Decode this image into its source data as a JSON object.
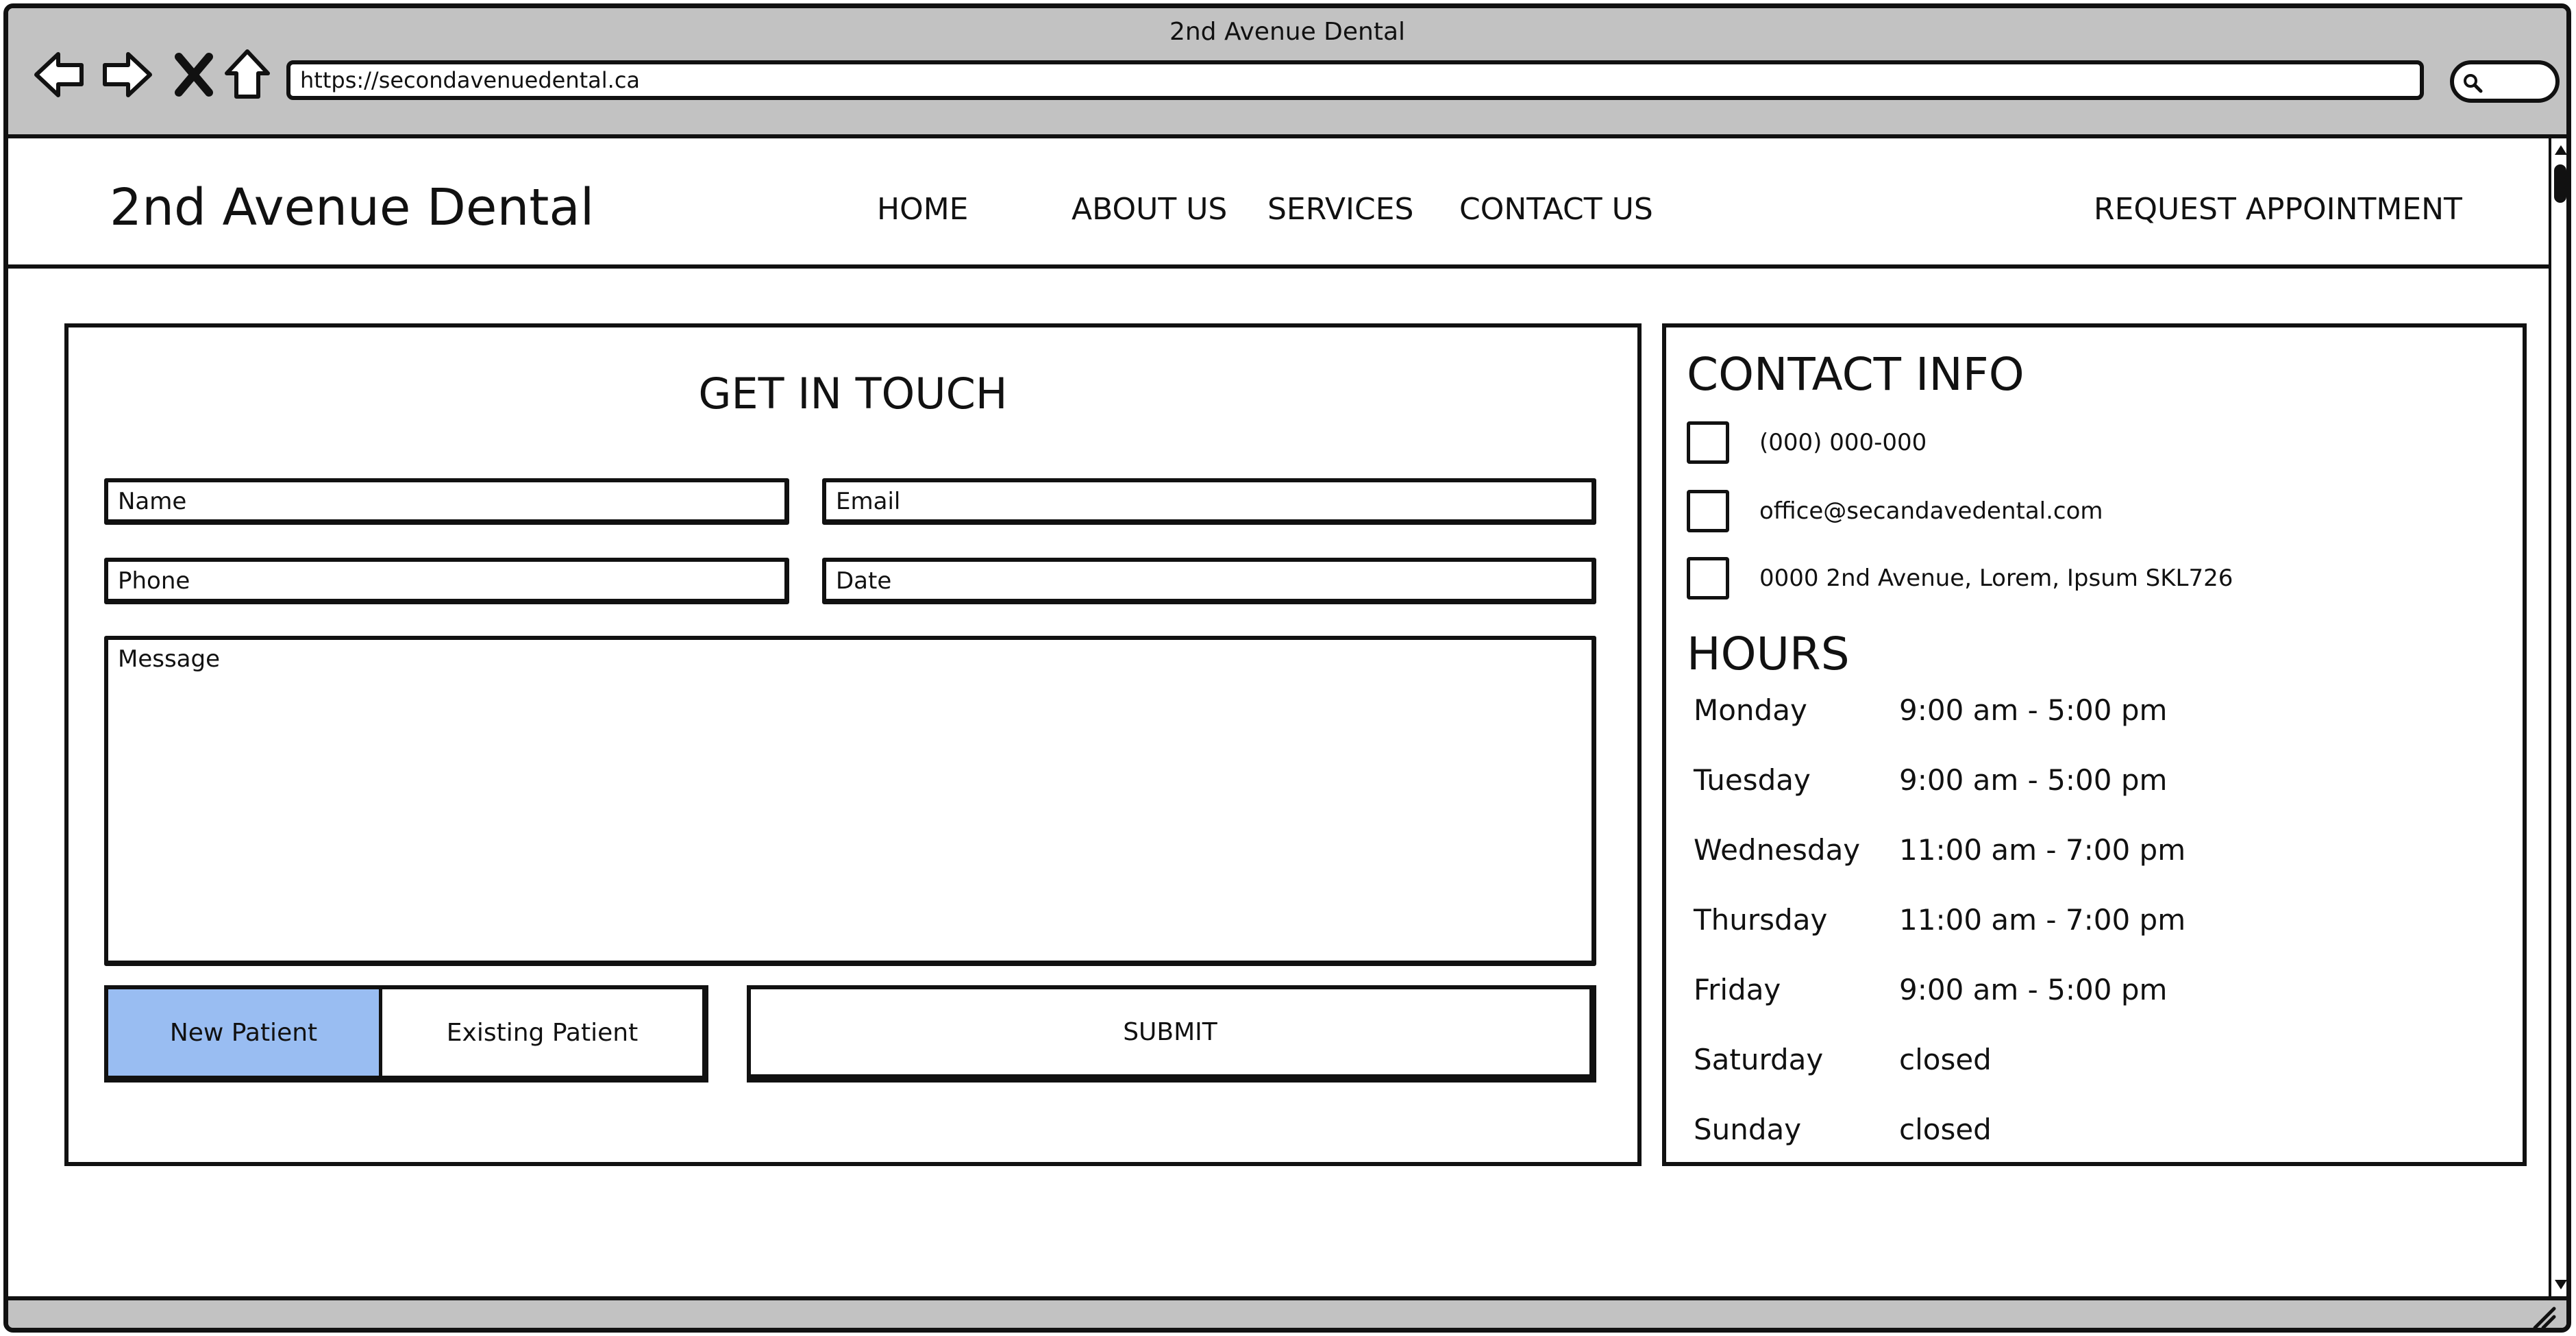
{
  "window": {
    "title": "2nd Avenue Dental",
    "url": "https://secondavenuedental.ca",
    "nav_icons": [
      "back-arrow-icon",
      "forward-arrow-icon",
      "close-icon",
      "home-icon"
    ]
  },
  "site": {
    "brand": "2nd Avenue Dental",
    "menu": {
      "home": "HOME",
      "about": "ABOUT US",
      "services": "SERVICES",
      "contact": "CONTACT US",
      "request": "REQUEST APPOINTMENT"
    }
  },
  "form": {
    "title": "GET IN TOUCH",
    "fields": {
      "name": "Name",
      "email": "Email",
      "phone": "Phone",
      "date": "Date",
      "message": "Message"
    },
    "patient_type": {
      "options": [
        "New Patient",
        "Existing Patient"
      ],
      "selected": "New Patient",
      "selected_color": "#99bdf2"
    },
    "submit_label": "SUBMIT"
  },
  "contact_info": {
    "title": "CONTACT INFO",
    "phone": "(000) 000-000",
    "email": "office@secandavedental.com",
    "address": "0000 2nd Avenue, Lorem, Ipsum SKL726"
  },
  "hours": {
    "title": "HOURS",
    "rows": [
      {
        "day": "Monday",
        "time": "9:00 am - 5:00 pm"
      },
      {
        "day": "Tuesday",
        "time": "9:00 am - 5:00 pm"
      },
      {
        "day": "Wednesday",
        "time": "11:00 am - 7:00 pm"
      },
      {
        "day": "Thursday",
        "time": "11:00 am - 7:00 pm"
      },
      {
        "day": "Friday",
        "time": "9:00 am - 5:00 pm"
      },
      {
        "day": "Saturday",
        "time": "closed"
      },
      {
        "day": "Sunday",
        "time": "closed"
      }
    ]
  }
}
